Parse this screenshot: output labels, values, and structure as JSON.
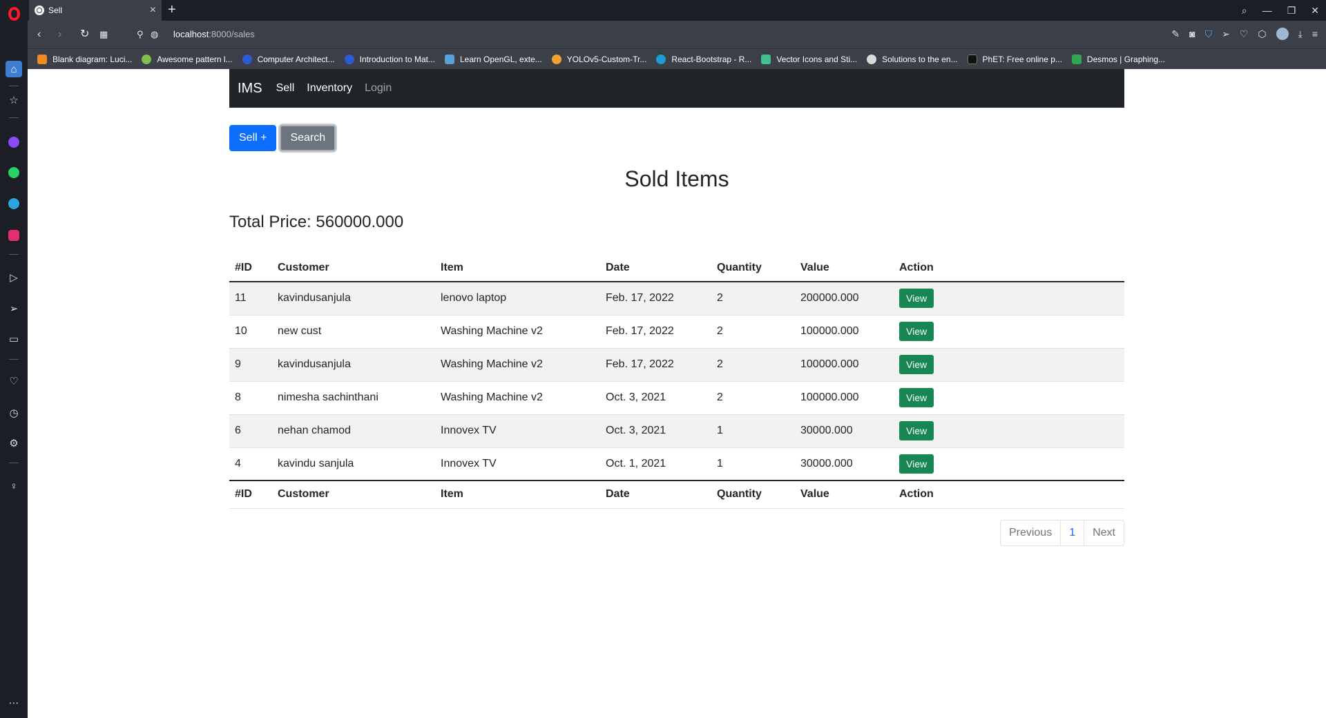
{
  "browser": {
    "tab_title": "Sell",
    "url_host": "localhost",
    "url_rest": ":8000/sales",
    "bookmarks": [
      "Blank diagram: Luci...",
      "Awesome pattern l...",
      "Computer Architect...",
      "Introduction to Mat...",
      "Learn OpenGL, exte...",
      "YOLOv5-Custom-Tr...",
      "React-Bootstrap - R...",
      "Vector Icons and Sti...",
      "Solutions to the en...",
      "PhET: Free online p...",
      "Desmos | Graphing..."
    ]
  },
  "navbar": {
    "brand": "IMS",
    "links": [
      "Sell",
      "Inventory",
      "Login"
    ]
  },
  "actions": {
    "sell": "Sell +",
    "search": "Search"
  },
  "page": {
    "title": "Sold Items",
    "total_label": "Total Price: 560000.000"
  },
  "table": {
    "headers": [
      "#ID",
      "Customer",
      "Item",
      "Date",
      "Quantity",
      "Value",
      "Action"
    ],
    "rows": [
      {
        "id": "11",
        "customer": "kavindusanjula",
        "item": "lenovo laptop",
        "date": "Feb. 17, 2022",
        "quantity": "2",
        "value": "200000.000",
        "action": "View"
      },
      {
        "id": "10",
        "customer": "new cust",
        "item": "Washing Machine v2",
        "date": "Feb. 17, 2022",
        "quantity": "2",
        "value": "100000.000",
        "action": "View"
      },
      {
        "id": "9",
        "customer": "kavindusanjula",
        "item": "Washing Machine v2",
        "date": "Feb. 17, 2022",
        "quantity": "2",
        "value": "100000.000",
        "action": "View"
      },
      {
        "id": "8",
        "customer": "nimesha sachinthani",
        "item": "Washing Machine v2",
        "date": "Oct. 3, 2021",
        "quantity": "2",
        "value": "100000.000",
        "action": "View"
      },
      {
        "id": "6",
        "customer": "nehan chamod",
        "item": "Innovex TV",
        "date": "Oct. 3, 2021",
        "quantity": "1",
        "value": "30000.000",
        "action": "View"
      },
      {
        "id": "4",
        "customer": "kavindu sanjula",
        "item": "Innovex TV",
        "date": "Oct. 1, 2021",
        "quantity": "1",
        "value": "30000.000",
        "action": "View"
      }
    ]
  },
  "pagination": {
    "previous": "Previous",
    "current": "1",
    "next": "Next"
  }
}
